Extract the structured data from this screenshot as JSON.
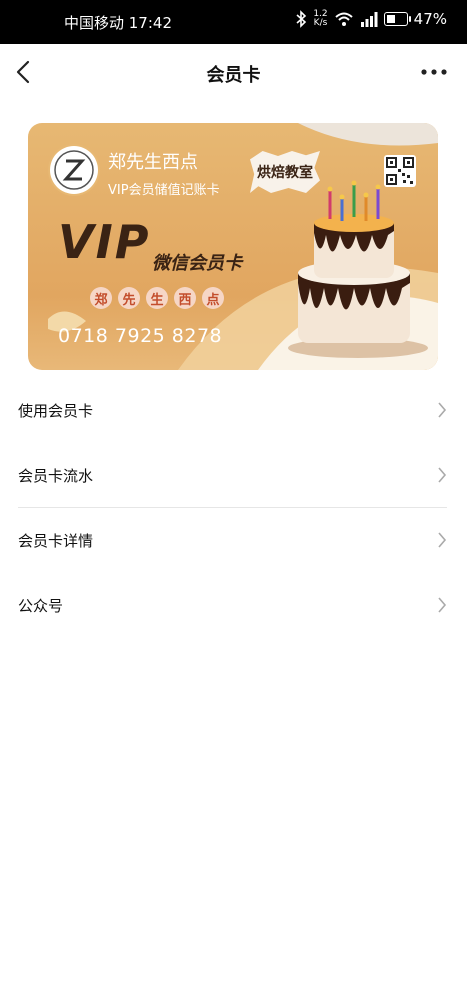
{
  "status_bar": {
    "carrier_time": "中国移动 17:42",
    "speed_value": "1.2",
    "speed_unit": "K/s",
    "battery": "47%",
    "battery_level": 0.47,
    "icons": [
      "bluetooth-icon",
      "wifi-icon",
      "signal-icon",
      "battery-icon"
    ]
  },
  "nav": {
    "title": "会员卡",
    "back_icon": "chevron-left-icon",
    "more_icon": "more-horizontal-icon"
  },
  "card": {
    "shop_name": "郑先生西点",
    "card_type": "VIP会员储值记账卡",
    "vip_text": "VIP",
    "wechat_card_text": "微信会员卡",
    "shop_name_chars": [
      "郑",
      "先",
      "生",
      "西",
      "点"
    ],
    "badge_text": "烘焙教室",
    "phone": "0718 7925 8278",
    "colors": {
      "background": "#e1a660",
      "vip_text": "#3a2314",
      "badge": "#f8f2ea"
    }
  },
  "menu": {
    "items": [
      {
        "label": "使用会员卡"
      },
      {
        "label": "会员卡流水"
      },
      {
        "label": "会员卡详情"
      },
      {
        "label": "公众号"
      }
    ]
  }
}
